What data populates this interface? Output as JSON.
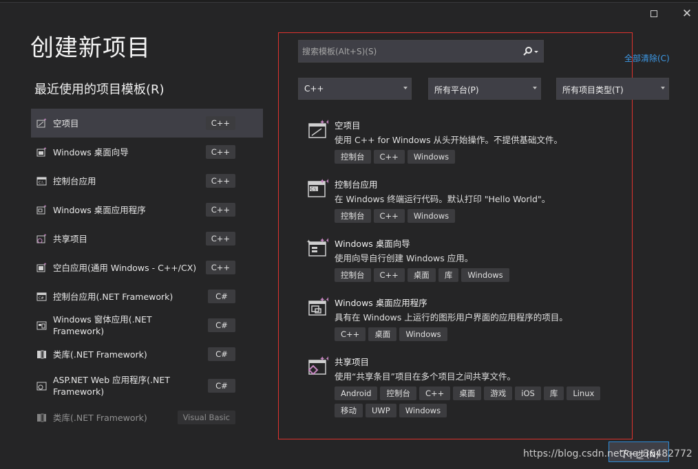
{
  "page_title": "创建新项目",
  "recent_title": "最近使用的项目模板(R)",
  "recent_templates": [
    {
      "label": "空项目",
      "tag": "C++",
      "icon": "empty-project-icon"
    },
    {
      "label": "Windows 桌面向导",
      "tag": "C++",
      "icon": "desktop-wizard-icon"
    },
    {
      "label": "控制台应用",
      "tag": "C++",
      "icon": "console-app-icon"
    },
    {
      "label": "Windows 桌面应用程序",
      "tag": "C++",
      "icon": "desktop-app-icon"
    },
    {
      "label": "共享项目",
      "tag": "C++",
      "icon": "shared-project-icon"
    },
    {
      "label": "空白应用(通用 Windows - C++/CX)",
      "tag": "C++",
      "icon": "blank-app-icon"
    },
    {
      "label": "控制台应用(.NET Framework)",
      "tag": "C#",
      "icon": "console-app-icon"
    },
    {
      "label": "Windows 窗体应用(.NET Framework)",
      "tag": "C#",
      "icon": "forms-app-icon"
    },
    {
      "label": "类库(.NET Framework)",
      "tag": "C#",
      "icon": "class-library-icon"
    },
    {
      "label": "ASP.NET Web 应用程序(.NET Framework)",
      "tag": "C#",
      "icon": "web-app-icon"
    },
    {
      "label": "类库(.NET Framework)",
      "tag": "Visual Basic",
      "icon": "class-library-icon"
    }
  ],
  "search": {
    "placeholder": "搜索模板(Alt+S)(S)",
    "value": ""
  },
  "clear_all": "全部清除(C)",
  "filters": {
    "language": "C++",
    "platform": "所有平台(P)",
    "project_type": "所有项目类型(T)"
  },
  "templates": [
    {
      "name": "空项目",
      "desc": "使用 C++ for Windows 从头开始操作。不提供基础文件。",
      "tags": [
        "控制台",
        "C++",
        "Windows"
      ],
      "icon": "empty-project-icon"
    },
    {
      "name": "控制台应用",
      "desc": "在 Windows 终端运行代码。默认打印 \"Hello World\"。",
      "tags": [
        "控制台",
        "C++",
        "Windows"
      ],
      "icon": "console-app-icon"
    },
    {
      "name": "Windows 桌面向导",
      "desc": "使用向导自行创建 Windows 应用。",
      "tags": [
        "控制台",
        "C++",
        "桌面",
        "库",
        "Windows"
      ],
      "icon": "desktop-wizard-icon"
    },
    {
      "name": "Windows 桌面应用程序",
      "desc": "具有在 Windows 上运行的图形用户界面的应用程序的项目。",
      "tags": [
        "C++",
        "桌面",
        "Windows"
      ],
      "icon": "desktop-app-icon"
    },
    {
      "name": "共享项目",
      "desc": "使用“共享条目”项目在多个项目之间共享文件。",
      "tags": [
        "Android",
        "控制台",
        "C++",
        "桌面",
        "游戏",
        "iOS",
        "库",
        "Linux",
        "移动",
        "UWP",
        "Windows"
      ],
      "icon": "shared-project-icon"
    }
  ],
  "next_button": "下一步(N)",
  "watermark": "https://blog.csdn.net/qq_36482772",
  "colors": {
    "background": "#252526",
    "accent": "#3e9be9",
    "highlight": "#e0332e",
    "sparkle": "#c586c0"
  }
}
